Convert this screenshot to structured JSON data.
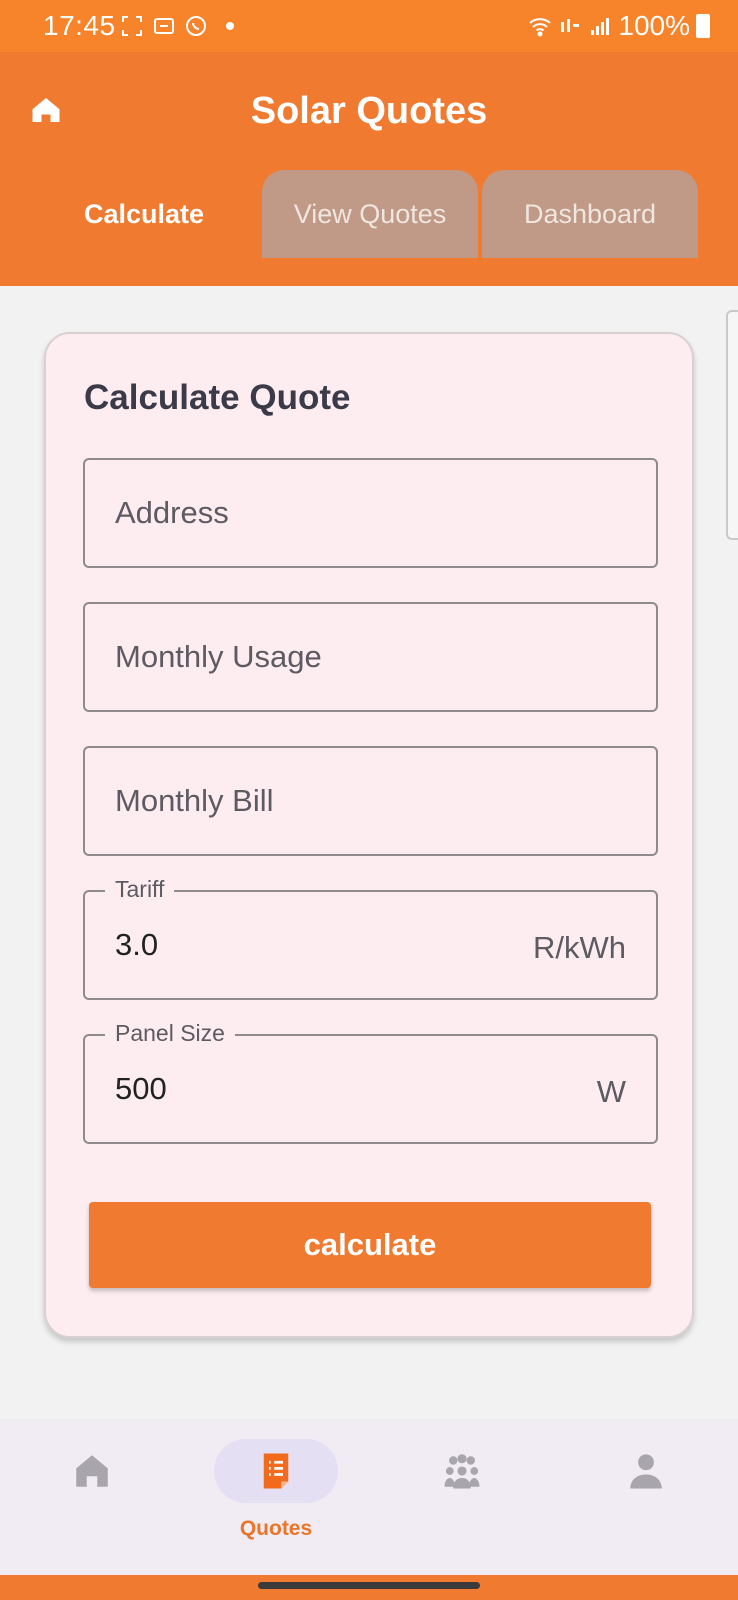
{
  "status_bar": {
    "time": "17:45",
    "battery": "100%"
  },
  "app_bar": {
    "title": "Solar Quotes",
    "tabs": [
      {
        "label": "Calculate",
        "active": true
      },
      {
        "label": "View Quotes",
        "active": false
      },
      {
        "label": "Dashboard",
        "active": false
      }
    ]
  },
  "form": {
    "title": "Calculate Quote",
    "address": {
      "placeholder": "Address",
      "value": ""
    },
    "monthly_usage": {
      "placeholder": "Monthly Usage",
      "value": ""
    },
    "monthly_bill": {
      "placeholder": "Monthly Bill",
      "value": ""
    },
    "tariff": {
      "label": "Tariff",
      "value": "3.0",
      "suffix": "R/kWh"
    },
    "panel_size": {
      "label": "Panel Size",
      "value": "500",
      "suffix": "W"
    },
    "submit_label": "calculate"
  },
  "bottom_nav": {
    "items": [
      {
        "icon": "home-icon",
        "label": ""
      },
      {
        "icon": "document-list-icon",
        "label": "Quotes",
        "active": true
      },
      {
        "icon": "group-icon",
        "label": ""
      },
      {
        "icon": "person-icon",
        "label": ""
      }
    ]
  },
  "colors": {
    "primary": "#f07a30",
    "status_bar": "#f7832a",
    "inactive_tab": "#c09a86",
    "card_bg": "#fdedf0",
    "nav_bg": "#f1ecf4",
    "active_nav_pill": "#e4dff3"
  }
}
